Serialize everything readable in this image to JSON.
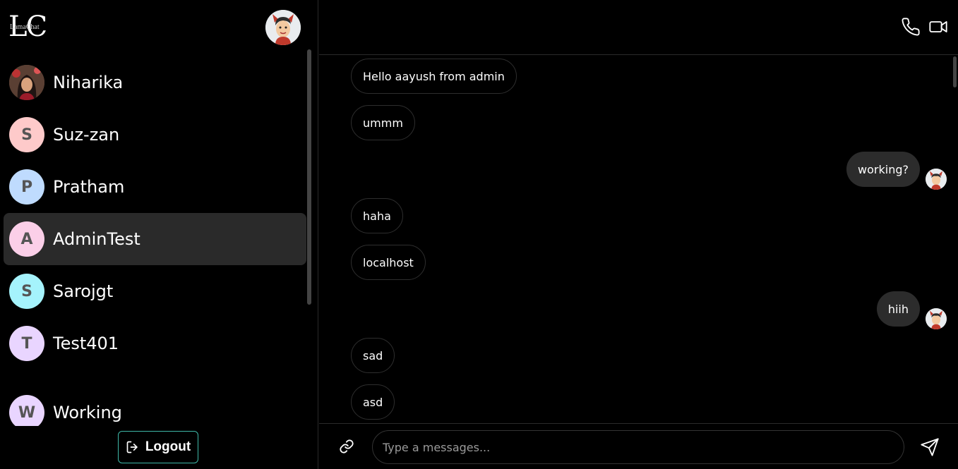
{
  "app": {
    "logo_main": "LC",
    "logo_sub": "LamaChat"
  },
  "contacts": [
    {
      "initial": "",
      "name": "Niharika",
      "color": "#7a5a4a",
      "photo": true
    },
    {
      "initial": "S",
      "name": "Suz-zan",
      "color": "#fecaca"
    },
    {
      "initial": "P",
      "name": "Pratham",
      "color": "#bfdbfe"
    },
    {
      "initial": "A",
      "name": "AdminTest",
      "color": "#fbcfe8",
      "active": true
    },
    {
      "initial": "S",
      "name": "Sarojgt",
      "color": "#a5f3fc"
    },
    {
      "initial": "T",
      "name": "Test401",
      "color": "#e9d5ff"
    },
    {
      "initial": "W",
      "name": "Working",
      "color": "#e9d5ff"
    }
  ],
  "logout": {
    "label": "Logout"
  },
  "messages": [
    {
      "text": "Hello aayush from admin",
      "dir": "in"
    },
    {
      "text": "ummm",
      "dir": "in"
    },
    {
      "text": "working?",
      "dir": "out"
    },
    {
      "text": "haha",
      "dir": "in"
    },
    {
      "text": "localhost",
      "dir": "in"
    },
    {
      "text": "hiih",
      "dir": "out"
    },
    {
      "text": "sad",
      "dir": "in"
    },
    {
      "text": "asd",
      "dir": "in"
    }
  ],
  "composer": {
    "placeholder": "Type a messages..."
  },
  "icons": {
    "call": "phone-icon",
    "video": "video-icon",
    "attach": "link-icon",
    "send": "send-icon",
    "logout": "logout-icon"
  },
  "colors": {
    "logout_border": "#3fb8a8",
    "active_row": "#2a2a2a",
    "outgoing_bubble": "#2c2c2c"
  }
}
